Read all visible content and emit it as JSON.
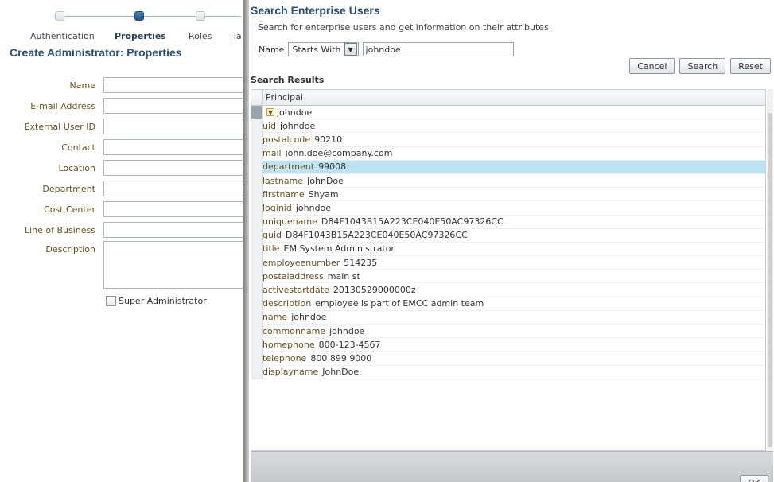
{
  "wizard": {
    "steps": [
      {
        "label": "Authentication",
        "active": false
      },
      {
        "label": "Properties",
        "active": true
      },
      {
        "label": "Roles",
        "active": false
      },
      {
        "label": "Ta",
        "active": false
      }
    ],
    "page_title": "Create Administrator: Properties",
    "fields": [
      {
        "label": "Name"
      },
      {
        "label": "E-mail Address"
      },
      {
        "label": "External User ID"
      },
      {
        "label": "Contact"
      },
      {
        "label": "Location"
      },
      {
        "label": "Department"
      },
      {
        "label": "Cost Center"
      },
      {
        "label": "Line of Business"
      },
      {
        "label": "Description"
      }
    ],
    "super_admin_label": "Super Administrator"
  },
  "dialog": {
    "title": "Search Enterprise Users",
    "subtitle": "Search for enterprise users and get information on their attributes",
    "name_label": "Name",
    "match_option": "Starts With",
    "search_value": "johndoe",
    "buttons": {
      "cancel": "Cancel",
      "search": "Search",
      "reset": "Reset",
      "ok": "OK"
    },
    "results_title": "Search Results",
    "column_header": "Principal",
    "principal": "johndoe",
    "attributes": [
      {
        "name": "uid",
        "value": "johndoe"
      },
      {
        "name": "postalcode",
        "value": "90210"
      },
      {
        "name": "mail",
        "value": "john.doe@company.com"
      },
      {
        "name": "department",
        "value": "99008"
      },
      {
        "name": "lastname",
        "value": "JohnDoe"
      },
      {
        "name": "firstname",
        "value": "Shyam"
      },
      {
        "name": "loginid",
        "value": "johndoe"
      },
      {
        "name": "uniquename",
        "value": "D84F1043B15A223CE040E50AC97326CC"
      },
      {
        "name": "guid",
        "value": "D84F1043B15A223CE040E50AC97326CC"
      },
      {
        "name": "title",
        "value": "EM System Administrator"
      },
      {
        "name": "employeenumber",
        "value": "514235"
      },
      {
        "name": "postaladdress",
        "value": "main st"
      },
      {
        "name": "activestartdate",
        "value": "20130529000000z"
      },
      {
        "name": "description",
        "value": "employee is part of EMCC admin team"
      },
      {
        "name": "name",
        "value": "johndoe"
      },
      {
        "name": "commonname",
        "value": "johndoe"
      },
      {
        "name": "homephone",
        "value": "800-123-4567"
      },
      {
        "name": "telephone",
        "value": "800 899 9000"
      },
      {
        "name": "displayname",
        "value": "JohnDoe"
      }
    ],
    "selected_attribute": "department"
  },
  "colors": {
    "title_blue": "#2c5078",
    "label_brown": "#6b5022",
    "selected_row": "#bde2f2"
  },
  "icons": {
    "expander": "collapse-triangle-icon",
    "dropdown": "chevron-down-icon"
  }
}
